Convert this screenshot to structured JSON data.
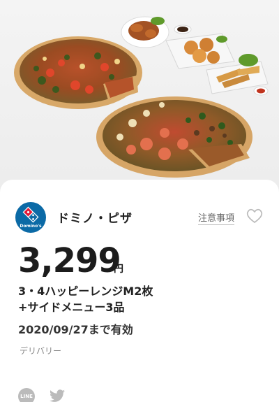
{
  "hero": {
    "image_icon": "pizza-and-sides-photo"
  },
  "brand": {
    "name": "ドミノ・ピザ",
    "logo_text": "Domino's",
    "notice_link": "注意事項",
    "favorite_icon": "heart-icon"
  },
  "offer": {
    "price": "3,299",
    "currency": "円",
    "product_line1": "3・4ハッピーレンジM2枚",
    "product_line2": "+サイドメニュー3品",
    "expiry": "2020/09/27まで有効",
    "service_type": "デリバリー"
  },
  "share": {
    "line_label": "LINE",
    "twitter_icon": "twitter-bird-icon"
  },
  "colors": {
    "brand_blue": "#0b6aa6",
    "brand_red": "#e31837",
    "text_dark": "#1c1c1c",
    "icon_gray": "#bbbbbb"
  }
}
